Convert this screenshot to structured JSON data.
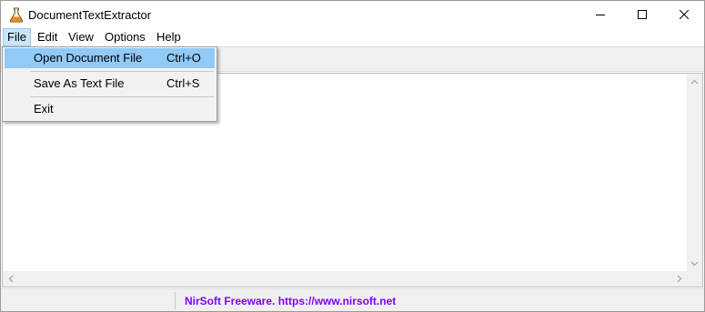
{
  "window": {
    "title": "DocumentTextExtractor",
    "icon": "flask-icon"
  },
  "menubar": {
    "file": "File",
    "edit": "Edit",
    "view": "View",
    "options": "Options",
    "help": "Help"
  },
  "file_menu": {
    "open_label": "Open Document File",
    "open_shortcut": "Ctrl+O",
    "save_label": "Save As Text File",
    "save_shortcut": "Ctrl+S",
    "exit_label": "Exit"
  },
  "statusbar": {
    "panel1": "",
    "link_text": "NirSoft Freeware. https://www.nirsoft.net"
  },
  "colors": {
    "link": "#8000ff",
    "menu_highlight": "#91c9f7",
    "menu_active": "#cce4f7"
  }
}
